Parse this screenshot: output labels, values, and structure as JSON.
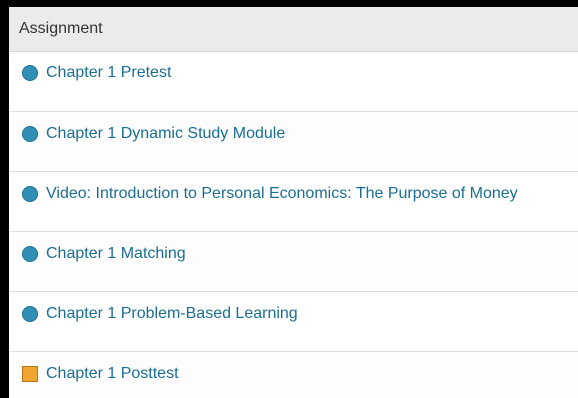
{
  "table": {
    "header": "Assignment",
    "rows": [
      {
        "label": "Chapter 1 Pretest",
        "icon": "circle"
      },
      {
        "label": "Chapter 1 Dynamic Study Module",
        "icon": "circle"
      },
      {
        "label": "Video: Introduction to Personal Economics: The Purpose of Money",
        "icon": "circle"
      },
      {
        "label": "Chapter 1 Matching",
        "icon": "circle"
      },
      {
        "label": "Chapter 1 Problem-Based Learning",
        "icon": "circle"
      },
      {
        "label": "Chapter 1 Posttest",
        "icon": "square"
      }
    ]
  },
  "colors": {
    "link": "#1a6e93",
    "circle_icon": "#2f8fb6",
    "square_icon": "#f0a531",
    "header_bg": "#ebebeb"
  }
}
